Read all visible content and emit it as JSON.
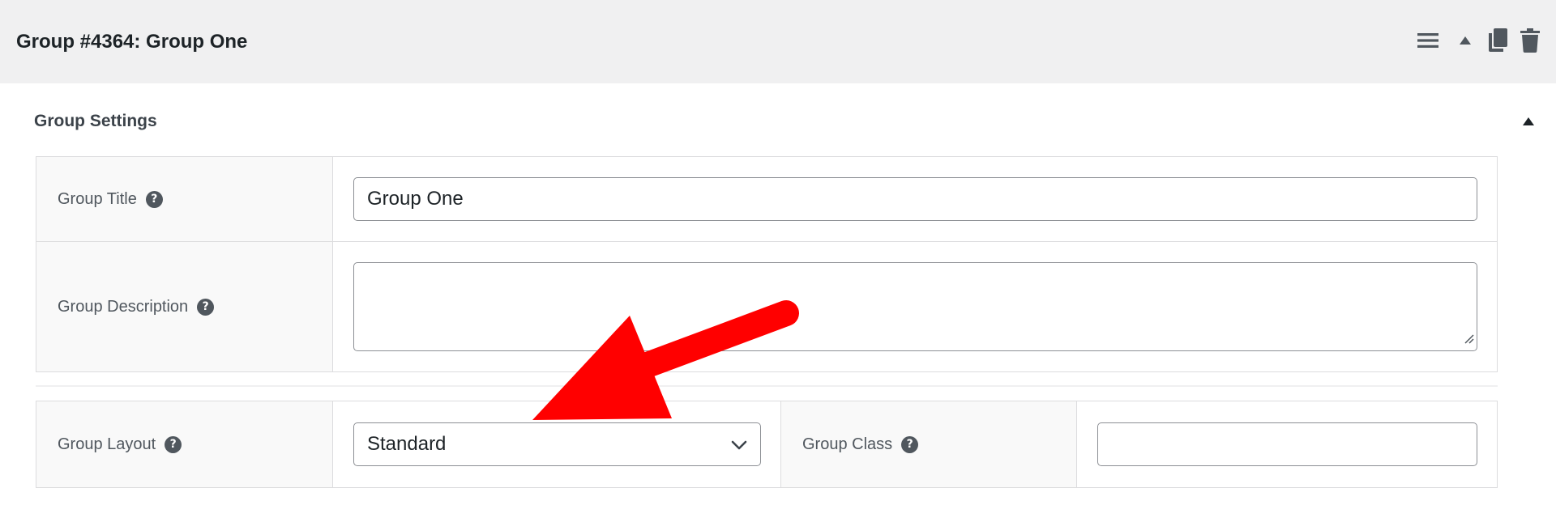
{
  "header": {
    "title": "Group #4364: Group One",
    "actions": [
      {
        "icon": "menu-icon"
      },
      {
        "icon": "triangle-up-icon"
      },
      {
        "icon": "copy-icon"
      },
      {
        "icon": "trash-icon"
      }
    ]
  },
  "section": {
    "title": "Group Settings",
    "toggle_icon": "triangle-up-icon"
  },
  "fields": {
    "group_title": {
      "label": "Group Title",
      "value": "Group One"
    },
    "group_description": {
      "label": "Group Description",
      "value": ""
    },
    "group_layout": {
      "label": "Group Layout",
      "selected": "Standard"
    },
    "group_class": {
      "label": "Group Class",
      "value": ""
    }
  },
  "help_glyph": "?",
  "colors": {
    "header_bg": "#f0f0f1",
    "arrow": "#ff0000",
    "icon": "#50575e"
  }
}
